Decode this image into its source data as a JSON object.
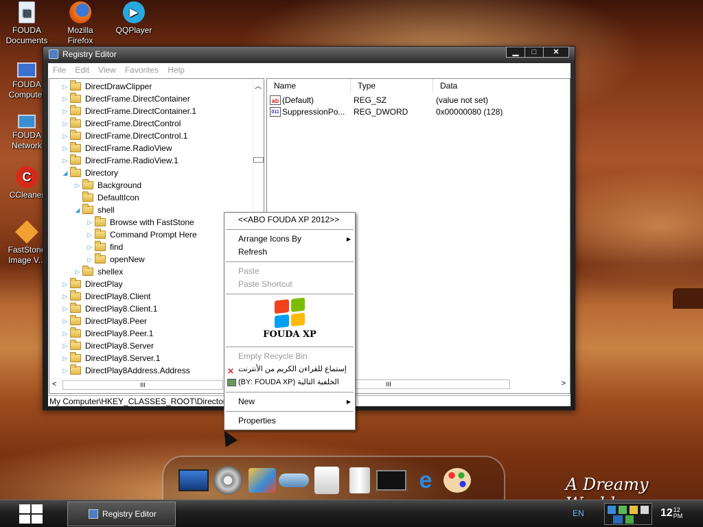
{
  "desktop": {
    "icons": [
      {
        "label": "FOUDA Documents",
        "icon": "documents-icon"
      },
      {
        "label": "Mozilla Firefox",
        "icon": "firefox-icon"
      },
      {
        "label": "QQPlayer",
        "icon": "qqplayer-icon"
      },
      {
        "label": "FOUDA Computer",
        "icon": "computer-icon"
      },
      {
        "label": "FOUDA Network",
        "icon": "network-icon"
      },
      {
        "label": "CCleaner",
        "icon": "ccleaner-icon"
      },
      {
        "label": "FastStone Image V...",
        "icon": "faststone-icon"
      }
    ],
    "wallpaper_text": "A Dreamy World"
  },
  "window": {
    "title": "Registry Editor",
    "controls": [
      "▁",
      "□",
      "✕"
    ],
    "menu": [
      "File",
      "Edit",
      "View",
      "Favorites",
      "Help"
    ],
    "tree": [
      {
        "label": "DirectDrawClipper",
        "level": 0,
        "expander": "▷"
      },
      {
        "label": "DirectFrame.DirectContainer",
        "level": 0,
        "expander": "▷"
      },
      {
        "label": "DirectFrame.DirectContainer.1",
        "level": 0,
        "expander": "▷"
      },
      {
        "label": "DirectFrame.DirectControl",
        "level": 0,
        "expander": "▷"
      },
      {
        "label": "DirectFrame.DirectControl.1",
        "level": 0,
        "expander": "▷"
      },
      {
        "label": "DirectFrame.RadioView",
        "level": 0,
        "expander": "▷"
      },
      {
        "label": "DirectFrame.RadioView.1",
        "level": 0,
        "expander": "▷"
      },
      {
        "label": "Directory",
        "level": 0,
        "expander": "◢"
      },
      {
        "label": "Background",
        "level": 1,
        "expander": "▷"
      },
      {
        "label": "DefaultIcon",
        "level": 1,
        "expander": ""
      },
      {
        "label": "shell",
        "level": 1,
        "expander": "◢"
      },
      {
        "label": "Browse with FastStone",
        "level": 2,
        "expander": "▷"
      },
      {
        "label": "Command Prompt Here",
        "level": 2,
        "expander": "▷"
      },
      {
        "label": "find",
        "level": 2,
        "expander": "▷"
      },
      {
        "label": "openNew",
        "level": 2,
        "expander": "▷"
      },
      {
        "label": "shellex",
        "level": 1,
        "expander": "▷"
      },
      {
        "label": "DirectPlay",
        "level": 0,
        "expander": "▷"
      },
      {
        "label": "DirectPlay8.Client",
        "level": 0,
        "expander": "▷"
      },
      {
        "label": "DirectPlay8.Client.1",
        "level": 0,
        "expander": "▷"
      },
      {
        "label": "DirectPlay8.Peer",
        "level": 0,
        "expander": "▷"
      },
      {
        "label": "DirectPlay8.Peer.1",
        "level": 0,
        "expander": "▷"
      },
      {
        "label": "DirectPlay8.Server",
        "level": 0,
        "expander": "▷"
      },
      {
        "label": "DirectPlay8.Server.1",
        "level": 0,
        "expander": "▷"
      },
      {
        "label": "DirectPlay8Address.Address",
        "level": 0,
        "expander": "▷"
      }
    ],
    "list_headers": [
      "Name",
      "Type",
      "Data"
    ],
    "list_rows": [
      {
        "icon": "ab",
        "name": "(Default)",
        "type": "REG_SZ",
        "data": "(value not set)"
      },
      {
        "icon": "011",
        "name": "SuppressionPo...",
        "type": "REG_DWORD",
        "data": "0x00000080 (128)"
      }
    ],
    "status": "My Computer\\HKEY_CLASSES_ROOT\\Directory\\shell\\find",
    "scroll_grip": "III"
  },
  "context_menu": {
    "header": "<<ABO FOUDA XP 2012>>",
    "arrange": "Arrange Icons By",
    "refresh": "Refresh",
    "paste": "Paste",
    "paste_shortcut": "Paste Shortcut",
    "logo_text": "FOUDA XP",
    "empty_bin": "Empty Recycle Bin",
    "quran": "إستماع للقراءن الكريم من الأنترنت",
    "wallpaper_next": "(BY: FOUDA XP) الخلفية التالية",
    "new": "New",
    "properties": "Properties"
  },
  "taskbar": {
    "task": "Registry Editor",
    "language": "EN",
    "time": "12",
    "time_small": "12",
    "ampm": "PM"
  }
}
